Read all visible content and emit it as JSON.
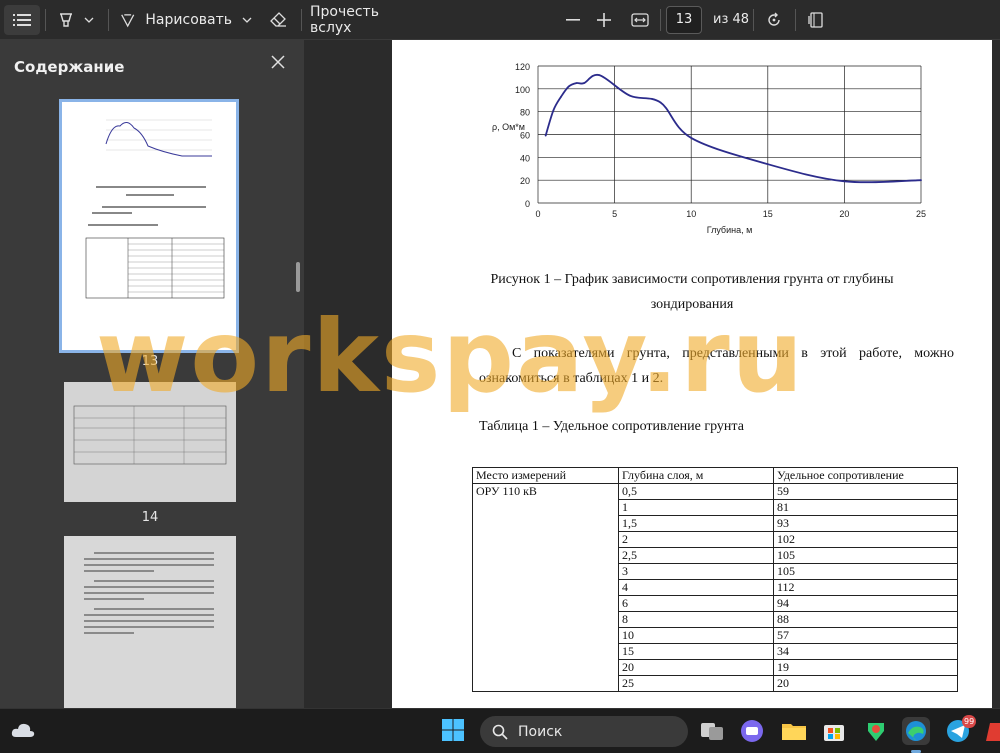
{
  "toolbar": {
    "draw_label": "Нарисовать",
    "read_aloud_label": "Прочесть вслух",
    "page_current": "13",
    "page_total": "из 48"
  },
  "sidebar": {
    "title": "Содержание",
    "thumbs": [
      {
        "label": "13"
      },
      {
        "label": "14"
      }
    ]
  },
  "document": {
    "figure_caption_line1": "Рисунок 1 – График зависимости сопротивления грунта от глубины",
    "figure_caption_line2": "зондирования",
    "paragraph_line1": "С показателями грунта, представленными в этой работе, можно",
    "paragraph_line2": "ознакомиться в таблицах 1 и 2.",
    "table_title": "Таблица 1 – Удельное сопротивление грунта",
    "table": {
      "headers": [
        "Место измерений",
        "Глубина слоя, м",
        "Удельное сопротивление"
      ],
      "location": "ОРУ 110 кВ",
      "rows": [
        [
          "0,5",
          "59"
        ],
        [
          "1",
          "81"
        ],
        [
          "1,5",
          "93"
        ],
        [
          "2",
          "102"
        ],
        [
          "2,5",
          "105"
        ],
        [
          "3",
          "105"
        ],
        [
          "4",
          "112"
        ],
        [
          "6",
          "94"
        ],
        [
          "8",
          "88"
        ],
        [
          "10",
          "57"
        ],
        [
          "15",
          "34"
        ],
        [
          "20",
          "19"
        ],
        [
          "25",
          "20"
        ]
      ]
    }
  },
  "chart_data": {
    "type": "line",
    "xlabel": "Глубина, м",
    "ylabel": "ρ, Ом*м",
    "xlim": [
      0,
      25
    ],
    "ylim": [
      0,
      120
    ],
    "xticks": [
      "0",
      "5",
      "10",
      "15",
      "20",
      "25"
    ],
    "yticks": [
      "0",
      "20",
      "40",
      "60",
      "80",
      "100",
      "120"
    ],
    "grid": true,
    "color": "#2c2c8c",
    "x": [
      0.5,
      1,
      1.5,
      2,
      2.5,
      3,
      4,
      6,
      8,
      10,
      15,
      20,
      25
    ],
    "y": [
      59,
      81,
      93,
      102,
      105,
      105,
      112,
      94,
      88,
      57,
      34,
      19,
      20
    ]
  },
  "watermark": "workspay.ru",
  "taskbar": {
    "search_label": "Поиск",
    "badge_count": "99"
  },
  "colors": {
    "accent": "#6fa8dc",
    "watermark": "#f0aa28"
  }
}
